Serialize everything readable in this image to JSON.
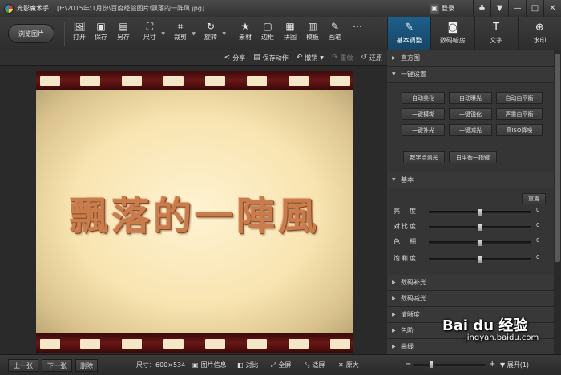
{
  "titlebar": {
    "app_name": "光影魔术手",
    "file_path": "[F:\\2015年\\1月份\\百度经验图片\\飘落的一阵风.jpg]",
    "login_label": "登录",
    "window_buttons": [
      "♣",
      "▼",
      "—",
      "□",
      "✕"
    ]
  },
  "toolbar": {
    "browse_label": "浏览图片",
    "tools": [
      {
        "label": "打开",
        "icon": "open-icon",
        "glyph": "🖼"
      },
      {
        "label": "保存",
        "icon": "save-icon",
        "glyph": "▣"
      },
      {
        "label": "另存",
        "icon": "save-as-icon",
        "glyph": "▤"
      },
      {
        "label": "尺寸",
        "icon": "resize-icon",
        "glyph": "⛶"
      },
      {
        "label": "裁剪",
        "icon": "crop-icon",
        "glyph": "⌗"
      },
      {
        "label": "旋转",
        "icon": "rotate-icon",
        "glyph": "↻"
      },
      {
        "label": "素材",
        "icon": "material-icon",
        "glyph": "★"
      },
      {
        "label": "边框",
        "icon": "border-icon",
        "glyph": "▢"
      },
      {
        "label": "拼图",
        "icon": "collage-icon",
        "glyph": "▦"
      },
      {
        "label": "模板",
        "icon": "template-icon",
        "glyph": "▥"
      },
      {
        "label": "画笔",
        "icon": "brush-icon",
        "glyph": "✎"
      },
      {
        "label": "",
        "icon": "more-icon",
        "glyph": "⋯"
      }
    ]
  },
  "right_tabs": [
    {
      "label": "基本调整",
      "icon": "adjust-icon",
      "glyph": "✎",
      "active": true
    },
    {
      "label": "数码暗房",
      "icon": "darkroom-icon",
      "glyph": "◙",
      "active": false
    },
    {
      "label": "文字",
      "icon": "text-icon",
      "glyph": "T",
      "active": false
    },
    {
      "label": "水印",
      "icon": "watermark-icon",
      "glyph": "⊕",
      "active": false
    }
  ],
  "actionbar": {
    "share": "分享",
    "save_action": "保存动作",
    "undo": "撤销",
    "redo": "重做",
    "restore": "还原"
  },
  "photo": {
    "text": "飄落的一陣風"
  },
  "right_panel": {
    "histogram": "直方图",
    "quick_settings": "一键设置",
    "quick_buttons": [
      "自动美化",
      "自动曝光",
      "自动白平衡",
      "一键模糊",
      "一键锐化",
      "严重白平衡",
      "一键补光",
      "一键减光",
      "高ISO降噪"
    ],
    "extra_buttons": [
      "数字点测光",
      "白平衡一指键"
    ],
    "basic": "基本",
    "reset": "重置",
    "sliders": [
      {
        "label": "亮　度",
        "value": 0,
        "position": 0.5
      },
      {
        "label": "对比度",
        "value": 0,
        "position": 0.5
      },
      {
        "label": "色　相",
        "value": 0,
        "position": 0.5
      },
      {
        "label": "饱和度",
        "value": 0,
        "position": 0.5
      }
    ],
    "sections": [
      "数码补光",
      "数码减光",
      "清晰度",
      "色阶",
      "曲线"
    ]
  },
  "bottombar": {
    "prev": "上一张",
    "next": "下一张",
    "delete": "删除",
    "size": "尺寸：600×534",
    "info": "图片信息",
    "compare": "对比",
    "fullscreen": "全屏",
    "fit": "适屏",
    "original": "原大",
    "zoom_level": 0.25,
    "expand": "展开(1)"
  },
  "watermark": {
    "logo": "Bai du 经验",
    "url": "jingyan.baidu.com"
  }
}
